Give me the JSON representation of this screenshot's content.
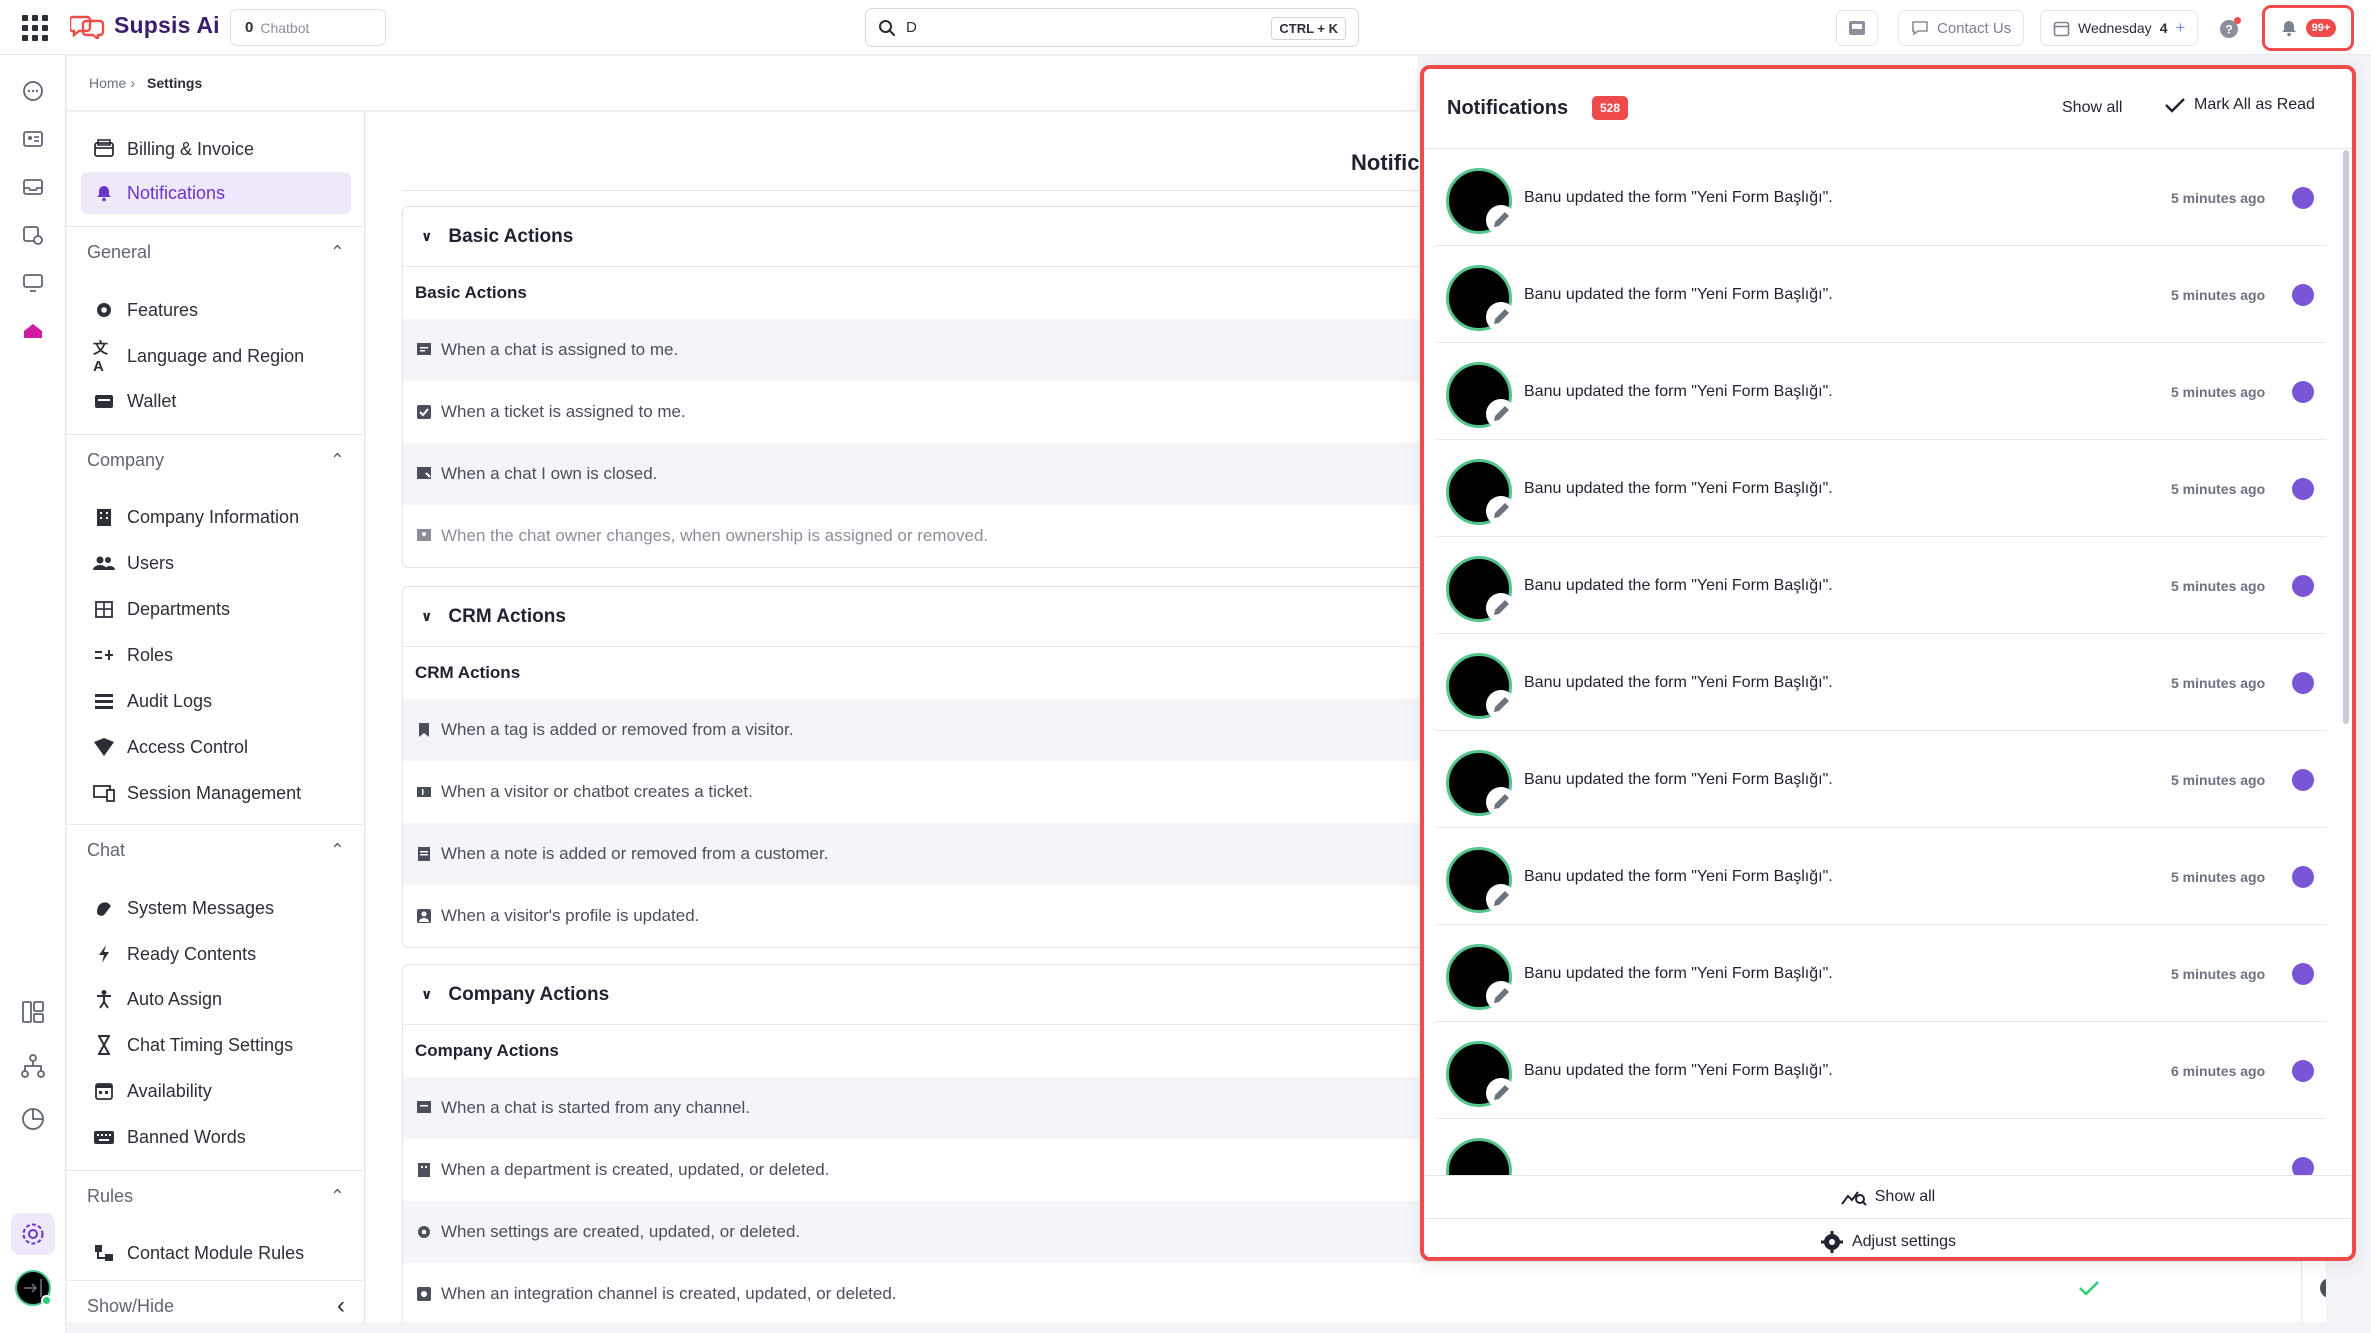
{
  "topbar": {
    "app_name": "Supsis Ai",
    "chatbot_count": "0",
    "chatbot_label": "Chatbot",
    "search_value": "D",
    "search_shortcut": "CTRL + K",
    "contact_label": "Contact Us",
    "date_label": "Wednesday",
    "date_day": "4",
    "notification_badge": "99+"
  },
  "breadcrumb": {
    "home": "Home",
    "current": "Settings"
  },
  "sidebar": {
    "top_items": [
      {
        "label": "Billing & Invoice",
        "icon": "billing-icon"
      },
      {
        "label": "Notifications",
        "icon": "bell-icon",
        "active": true
      }
    ],
    "groups": [
      {
        "title": "General",
        "items": [
          {
            "label": "Features",
            "icon": "gear-icon"
          },
          {
            "label": "Language and Region",
            "icon": "translate-icon"
          },
          {
            "label": "Wallet",
            "icon": "wallet-icon"
          }
        ]
      },
      {
        "title": "Company",
        "items": [
          {
            "label": "Company Information",
            "icon": "building-icon"
          },
          {
            "label": "Users",
            "icon": "users-icon"
          },
          {
            "label": "Departments",
            "icon": "departments-icon"
          },
          {
            "label": "Roles",
            "icon": "roles-icon"
          },
          {
            "label": "Audit Logs",
            "icon": "list-icon"
          },
          {
            "label": "Access Control",
            "icon": "access-icon"
          },
          {
            "label": "Session Management",
            "icon": "devices-icon"
          }
        ]
      },
      {
        "title": "Chat",
        "items": [
          {
            "label": "System Messages",
            "icon": "wave-icon"
          },
          {
            "label": "Ready Contents",
            "icon": "bolt-icon"
          },
          {
            "label": "Auto Assign",
            "icon": "person-icon"
          },
          {
            "label": "Chat Timing Settings",
            "icon": "hourglass-icon"
          },
          {
            "label": "Availability",
            "icon": "calendar-icon"
          },
          {
            "label": "Banned Words",
            "icon": "keyboard-icon"
          }
        ]
      },
      {
        "title": "Rules",
        "items": [
          {
            "label": "Contact Module Rules",
            "icon": "rules-icon"
          }
        ]
      }
    ],
    "show_hide": "Show/Hide"
  },
  "main": {
    "title": "Notific",
    "sections": [
      {
        "title": "Basic Actions",
        "subtitle": "Basic Actions",
        "rows": [
          "When a chat is assigned to me.",
          "When a ticket is assigned to me.",
          "When a chat I own is closed.",
          "When the chat owner changes, when ownership is assigned or removed."
        ]
      },
      {
        "title": "CRM Actions",
        "subtitle": "CRM Actions",
        "rows": [
          "When a tag is added or removed from a visitor.",
          "When a visitor or chatbot creates a ticket.",
          "When a note is added or removed from a customer.",
          "When a visitor's profile is updated."
        ]
      },
      {
        "title": "Company Actions",
        "subtitle": "Company Actions",
        "rows": [
          "When a chat is started from any channel.",
          "When a department is created, updated, or deleted.",
          "When settings are created, updated, or deleted.",
          "When an integration channel is created, updated, or deleted."
        ]
      }
    ]
  },
  "notifications": {
    "title": "Notifications",
    "count": "528",
    "show_all": "Show all",
    "mark_all": "Mark All as Read",
    "items": [
      {
        "text": "Banu updated the form \"Yeni Form Başlığı\".",
        "time": "5 minutes ago"
      },
      {
        "text": "Banu updated the form \"Yeni Form Başlığı\".",
        "time": "5 minutes ago"
      },
      {
        "text": "Banu updated the form \"Yeni Form Başlığı\".",
        "time": "5 minutes ago"
      },
      {
        "text": "Banu updated the form \"Yeni Form Başlığı\".",
        "time": "5 minutes ago"
      },
      {
        "text": "Banu updated the form \"Yeni Form Başlığı\".",
        "time": "5 minutes ago"
      },
      {
        "text": "Banu updated the form \"Yeni Form Başlığı\".",
        "time": "5 minutes ago"
      },
      {
        "text": "Banu updated the form \"Yeni Form Başlığı\".",
        "time": "5 minutes ago"
      },
      {
        "text": "Banu updated the form \"Yeni Form Başlığı\".",
        "time": "5 minutes ago"
      },
      {
        "text": "Banu updated the form \"Yeni Form Başlığı\".",
        "time": "5 minutes ago"
      },
      {
        "text": "Banu updated the form \"Yeni Form Başlığı\".",
        "time": "6 minutes ago"
      }
    ],
    "footer_show_all": "Show all",
    "footer_adjust": "Adjust settings"
  },
  "colors": {
    "accent": "#6a35c9",
    "unread_dot": "#7a55d6",
    "alert": "#ef4b4b",
    "online": "#2ecc71"
  }
}
